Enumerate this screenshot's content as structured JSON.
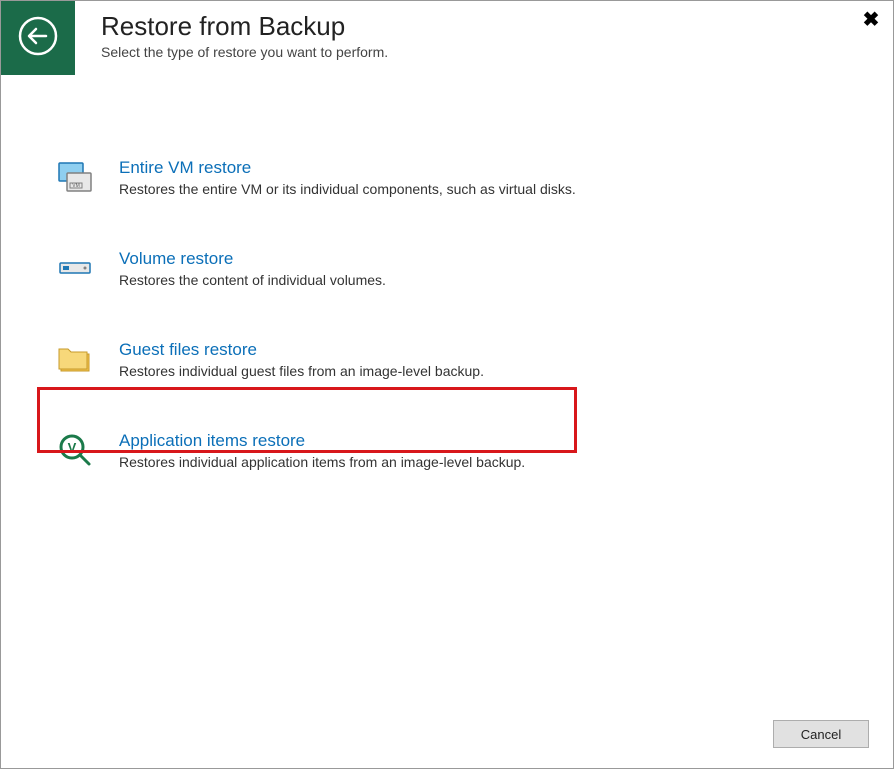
{
  "header": {
    "title": "Restore from Backup",
    "subtitle": "Select the type of restore you want to perform."
  },
  "options": [
    {
      "id": "entire-vm",
      "title": "Entire VM restore",
      "desc": "Restores the entire VM or its individual components, such as virtual disks."
    },
    {
      "id": "volume",
      "title": "Volume restore",
      "desc": "Restores the content of individual volumes."
    },
    {
      "id": "guest-files",
      "title": "Guest files restore",
      "desc": "Restores individual guest files from an image-level backup."
    },
    {
      "id": "app-items",
      "title": "Application items restore",
      "desc": "Restores individual application items from an image-level backup."
    }
  ],
  "highlighted_option_index": 3,
  "highlight_color": "#d8171b",
  "accent_green": "#1b6b49",
  "link_color": "#0b6fb8",
  "footer": {
    "cancel_label": "Cancel"
  }
}
